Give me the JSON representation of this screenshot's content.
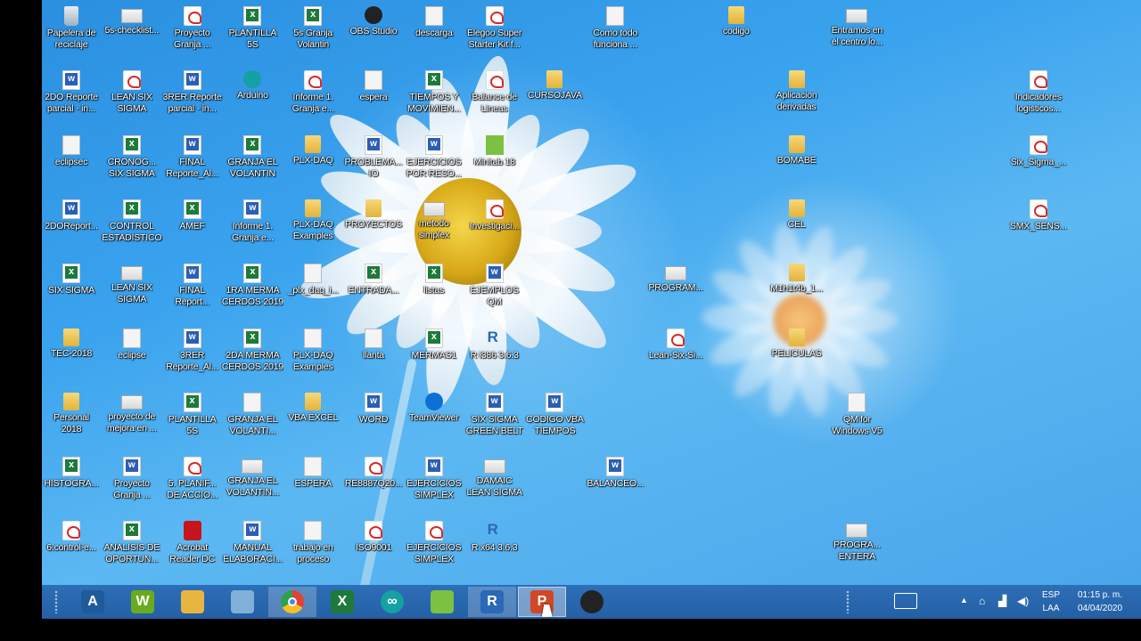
{
  "desktop": {
    "icons": [
      {
        "label": "Papelera de\nreciclaje",
        "type": "bin",
        "col": 0,
        "row": 0
      },
      {
        "label": "5s-checklist...",
        "type": "image",
        "col": 1,
        "row": 0
      },
      {
        "label": "Proyecto\nGranja ...",
        "type": "pdf",
        "col": 2,
        "row": 0
      },
      {
        "label": "PLANTILLA\n5S",
        "type": "excel",
        "col": 3,
        "row": 0
      },
      {
        "label": "5s Granja\nVolantin",
        "type": "excel",
        "col": 4,
        "row": 0
      },
      {
        "label": "OBS Studio",
        "type": "app",
        "col": 5,
        "row": 0
      },
      {
        "label": "descarga",
        "type": "generic",
        "col": 6,
        "row": 0
      },
      {
        "label": "Elegoo Super\nStarter Kit f...",
        "type": "pdf",
        "col": 7,
        "row": 0
      },
      {
        "label": "Como todo\nfunciona ...",
        "type": "generic",
        "col": 9,
        "row": 0
      },
      {
        "label": "codigo",
        "type": "folder",
        "col": 11,
        "row": 0
      },
      {
        "label": "Entramos en\nel centro lo...",
        "type": "image",
        "col": 13,
        "row": 0
      },
      {
        "label": "2DO Reporte\nparcial - in...",
        "type": "word",
        "col": 0,
        "row": 1
      },
      {
        "label": "LEAN SIX\nSIGMA",
        "type": "pdf",
        "col": 1,
        "row": 1
      },
      {
        "label": "3RER Reporte\nparcial - in...",
        "type": "word",
        "col": 2,
        "row": 1
      },
      {
        "label": "Arduino",
        "type": "arduino",
        "col": 3,
        "row": 1
      },
      {
        "label": "Informe 1.\nGranja e...",
        "type": "pdf",
        "col": 4,
        "row": 1
      },
      {
        "label": "espera",
        "type": "generic",
        "col": 5,
        "row": 1
      },
      {
        "label": "TIEMPOS Y\nMOVIMIEN...",
        "type": "excel",
        "col": 6,
        "row": 1
      },
      {
        "label": "Balance de\nLineas",
        "type": "pdf",
        "col": 7,
        "row": 1
      },
      {
        "label": "CURSOJAVA",
        "type": "folder",
        "col": 8,
        "row": 1
      },
      {
        "label": "Aplicacion\nderivadas",
        "type": "folder",
        "col": 12,
        "row": 1
      },
      {
        "label": "Indicadores\nlogisticos...",
        "type": "pdf",
        "col": 16,
        "row": 1
      },
      {
        "label": "eclipsec",
        "type": "generic",
        "col": 0,
        "row": 2
      },
      {
        "label": "CRONOG...\nSIX SIGMA",
        "type": "excel",
        "col": 1,
        "row": 2
      },
      {
        "label": "FINAL\nReporte_Al...",
        "type": "word",
        "col": 2,
        "row": 2
      },
      {
        "label": "GRANJA EL\nVOLANTIN",
        "type": "excel",
        "col": 3,
        "row": 2
      },
      {
        "label": "PLX-DAQ",
        "type": "folder",
        "col": 4,
        "row": 2
      },
      {
        "label": "PROBLEMA...\nIO",
        "type": "word",
        "col": 5,
        "row": 2
      },
      {
        "label": "EJERCICIOS\nPOR RESO...",
        "type": "word",
        "col": 6,
        "row": 2
      },
      {
        "label": "Minitab 18",
        "type": "minitab",
        "col": 7,
        "row": 2
      },
      {
        "label": "BOMABE",
        "type": "folder",
        "col": 12,
        "row": 2
      },
      {
        "label": "Six_Sigma_...",
        "type": "pdf",
        "col": 16,
        "row": 2
      },
      {
        "label": "2DOReport...",
        "type": "word",
        "col": 0,
        "row": 3
      },
      {
        "label": "CONTROL\nESTADISTICO",
        "type": "excel",
        "col": 1,
        "row": 3
      },
      {
        "label": "AMEF",
        "type": "excel",
        "col": 2,
        "row": 3
      },
      {
        "label": "Informe 1.\nGranja e...",
        "type": "word",
        "col": 3,
        "row": 3
      },
      {
        "label": "PLX-DAQ\nExamples",
        "type": "folder",
        "col": 4,
        "row": 3
      },
      {
        "label": "PROYECTOS",
        "type": "folder",
        "col": 5,
        "row": 3
      },
      {
        "label": "metodo\nsimplex",
        "type": "image",
        "col": 6,
        "row": 3
      },
      {
        "label": "Investigaci...",
        "type": "pdf",
        "col": 7,
        "row": 3
      },
      {
        "label": "CEL",
        "type": "folder",
        "col": 12,
        "row": 3
      },
      {
        "label": "SMX_SENS...",
        "type": "pdf",
        "col": 16,
        "row": 3
      },
      {
        "label": "SIX SIGMA",
        "type": "excel",
        "col": 0,
        "row": 4
      },
      {
        "label": "LEAN SIX\nSIGMA",
        "type": "image",
        "col": 1,
        "row": 4
      },
      {
        "label": "FINAL\nReport...",
        "type": "word",
        "col": 2,
        "row": 4
      },
      {
        "label": "1RA MERMA\nCERDOS 2019",
        "type": "excel",
        "col": 3,
        "row": 4
      },
      {
        "label": "_plx_daq_i...",
        "type": "generic",
        "col": 4,
        "row": 4
      },
      {
        "label": "ENTRADA...",
        "type": "excel",
        "col": 5,
        "row": 4
      },
      {
        "label": "listas",
        "type": "excel",
        "col": 6,
        "row": 4
      },
      {
        "label": "EJEMPLOS\nQM",
        "type": "word",
        "col": 7,
        "row": 4
      },
      {
        "label": "PROGRAM...",
        "type": "image",
        "col": 10,
        "row": 4
      },
      {
        "label": "M1h1t4b_1...",
        "type": "folder",
        "col": 12,
        "row": 4
      },
      {
        "label": "TEC-2018",
        "type": "folder",
        "col": 0,
        "row": 5
      },
      {
        "label": "eclipse",
        "type": "generic",
        "col": 1,
        "row": 5
      },
      {
        "label": "3RER\nReporte_Al...",
        "type": "word",
        "col": 2,
        "row": 5
      },
      {
        "label": "2DA MERMA\nCERDOS 2019",
        "type": "excel",
        "col": 3,
        "row": 5
      },
      {
        "label": "PLX-DAQ\nExamples",
        "type": "generic",
        "col": 4,
        "row": 5
      },
      {
        "label": "llanta",
        "type": "generic",
        "col": 5,
        "row": 5
      },
      {
        "label": "MERMAS1",
        "type": "excel",
        "col": 6,
        "row": 5
      },
      {
        "label": "R i386 3.6.3",
        "type": "r",
        "col": 7,
        "row": 5
      },
      {
        "label": "Lean-Six-Si...",
        "type": "pdf",
        "col": 10,
        "row": 5
      },
      {
        "label": "PELICULAS",
        "type": "folder",
        "col": 12,
        "row": 5
      },
      {
        "label": "Personal\n2018",
        "type": "folder",
        "col": 0,
        "row": 6
      },
      {
        "label": "proyecto de\nmejora en ...",
        "type": "image",
        "col": 1,
        "row": 6
      },
      {
        "label": "PLANTILLA\n5S",
        "type": "excel",
        "col": 2,
        "row": 6
      },
      {
        "label": "GRANJA EL\nVOLANTI...",
        "type": "generic",
        "col": 3,
        "row": 6
      },
      {
        "label": "VBA EXCEL",
        "type": "folder",
        "col": 4,
        "row": 6
      },
      {
        "label": "WORD",
        "type": "word",
        "col": 5,
        "row": 6
      },
      {
        "label": "TeamViewer",
        "type": "teamviewer",
        "col": 6,
        "row": 6
      },
      {
        "label": "SIX SIGMA\nGREEN BELT",
        "type": "word",
        "col": 7,
        "row": 6
      },
      {
        "label": "CODIGO VBA\nTIEMPOS",
        "type": "word",
        "col": 8,
        "row": 6
      },
      {
        "label": "QM for\nWindows V5",
        "type": "generic",
        "col": 13,
        "row": 6
      },
      {
        "label": "HISTOGRA...",
        "type": "excel",
        "col": 0,
        "row": 7
      },
      {
        "label": "Proyecto\nGranja ...",
        "type": "word",
        "col": 1,
        "row": 7
      },
      {
        "label": "5. PLANIF...\nDE ACCIO...",
        "type": "pdf",
        "col": 2,
        "row": 7
      },
      {
        "label": "GRANJA EL\nVOLANTIN...",
        "type": "image",
        "col": 3,
        "row": 7
      },
      {
        "label": "ESPERA",
        "type": "generic",
        "col": 4,
        "row": 7
      },
      {
        "label": "RE8887Q20...",
        "type": "pdf",
        "col": 5,
        "row": 7
      },
      {
        "label": "EJERCICIOS\nSIMPLEX",
        "type": "word",
        "col": 6,
        "row": 7
      },
      {
        "label": "DAMAIC\nLEAN SIGMA",
        "type": "image",
        "col": 7,
        "row": 7
      },
      {
        "label": "BALANCEO...",
        "type": "word",
        "col": 9,
        "row": 7
      },
      {
        "label": "6.control-e...",
        "type": "pdf",
        "col": 0,
        "row": 8
      },
      {
        "label": "ANALISIS DE\nOPORTUN...",
        "type": "excel",
        "col": 1,
        "row": 8
      },
      {
        "label": "Acrobat\nReader DC",
        "type": "acrobat",
        "col": 2,
        "row": 8
      },
      {
        "label": "MANUAL\nELABORACI...",
        "type": "word",
        "col": 3,
        "row": 8
      },
      {
        "label": "trabajo en\nproceso",
        "type": "generic",
        "col": 4,
        "row": 8
      },
      {
        "label": "ISO9001",
        "type": "pdf",
        "col": 5,
        "row": 8
      },
      {
        "label": "EJERCICIOS\nSIMPLEX",
        "type": "pdf",
        "col": 6,
        "row": 8
      },
      {
        "label": "R x64 3.6.3",
        "type": "r",
        "col": 7,
        "row": 8
      },
      {
        "label": "PROGRA...\nENTERA",
        "type": "image",
        "col": 13,
        "row": 8
      }
    ]
  },
  "taskbar": {
    "apps": [
      {
        "name": "autocad-icon",
        "glyph": "A",
        "color": "#1f5a9a",
        "active": false
      },
      {
        "name": "wps-writer-icon",
        "glyph": "W",
        "color": "#6aaa1e",
        "active": false
      },
      {
        "name": "file-explorer-icon",
        "glyph": "",
        "color": "#e8b540",
        "active": false
      },
      {
        "name": "app-icon",
        "glyph": "",
        "color": "#7fb0d8",
        "active": false
      },
      {
        "name": "chrome-icon",
        "glyph": "",
        "color": "#e34133",
        "active": true
      },
      {
        "name": "excel-icon",
        "glyph": "X",
        "color": "#1d7a3b",
        "active": false
      },
      {
        "name": "arduino-icon",
        "glyph": "∞",
        "color": "#15a0a4",
        "active": false
      },
      {
        "name": "minitab-icon",
        "glyph": "",
        "color": "#7cc142",
        "active": false
      },
      {
        "name": "r-icon",
        "glyph": "R",
        "color": "#2a68b8",
        "active": true
      },
      {
        "name": "powerpoint-icon",
        "glyph": "P",
        "color": "#d24726",
        "active": "pressed"
      },
      {
        "name": "obs-icon",
        "glyph": "",
        "color": "#222",
        "active": false
      }
    ],
    "tray": {
      "lang_top": "ESP",
      "lang_bottom": "LAA",
      "time": "01:15 p. m.",
      "date": "04/04/2020"
    }
  }
}
